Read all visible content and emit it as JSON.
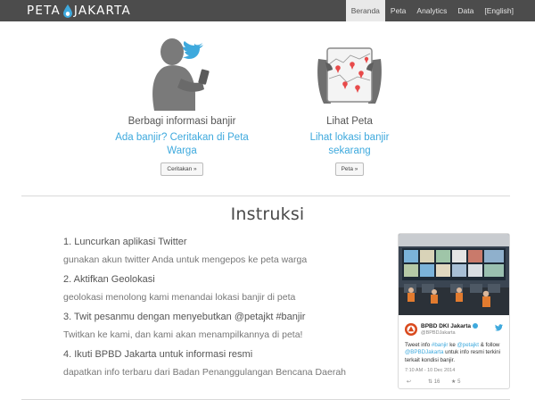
{
  "brand": {
    "left": "PETA",
    "right": "JAKARTA"
  },
  "nav": [
    {
      "label": "Beranda",
      "active": true
    },
    {
      "label": "Peta",
      "active": false
    },
    {
      "label": "Analytics",
      "active": false
    },
    {
      "label": "Data",
      "active": false
    },
    {
      "label": "[English]",
      "active": false
    }
  ],
  "features": {
    "share": {
      "title": "Berbagi informasi banjir",
      "link_line1": "Ada banjir? Ceritakan di Peta",
      "link_line2": "Warga",
      "button": "Ceritakan »"
    },
    "map": {
      "title": "Lihat Peta",
      "link_line1": "Lihat lokasi banjir",
      "link_line2": "sekarang",
      "button": "Peta »"
    }
  },
  "heading": "Instruksi",
  "steps": [
    {
      "title": "1. Luncurkan aplikasi Twitter",
      "desc": "gunakan akun twitter Anda untuk mengepos ke peta warga"
    },
    {
      "title": "2. Aktifkan Geolokasi",
      "desc": "geolokasi menolong kami menandai lokasi banjir di peta"
    },
    {
      "title": "3. Twit pesanmu dengan menyebutkan @petajkt #banjir",
      "desc": "Twitkan ke kami, dan kami akan menampilkannya di peta!"
    },
    {
      "title": "4. Ikuti BPBD Jakarta untuk informasi resmi",
      "desc": "dapatkan info terbaru dari Badan Penanggulangan Bencana Daerah"
    }
  ],
  "tweet": {
    "name": "BPBD DKI Jakarta",
    "handle": "@BPBDJakarta",
    "text_a": "Tweet info ",
    "text_b": "#banjir",
    "text_c": " ke ",
    "text_d": "@petajkt",
    "text_e": " & follow ",
    "text_f": "@BPBDJakarta",
    "text_g": " untuk info resmi terkini terkait kondisi banjir.",
    "time": "7:10 AM - 10 Dec 2014",
    "retweets": "16",
    "favorites": "5",
    "colors": {
      "link": "#3ea9dd",
      "avatar": "#d94a1e"
    }
  },
  "colors": {
    "navbar": "#4c4c4c",
    "accent": "#3ea9dd",
    "illustration": "#7a7a7a"
  }
}
